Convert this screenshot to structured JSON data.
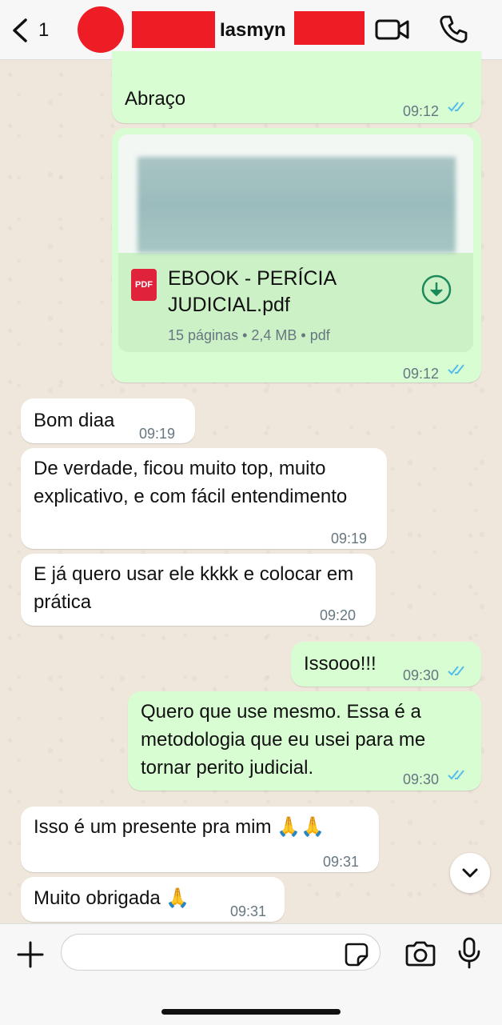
{
  "header": {
    "back_count": "1",
    "contact_name": "Iasmyn",
    "icons": {
      "back": "chevron-left-icon",
      "video": "video-camera-icon",
      "call": "phone-icon"
    }
  },
  "messages": [
    {
      "id": "m1",
      "direction": "out",
      "text": "Abraço",
      "time": "09:12",
      "read": true
    },
    {
      "id": "m2",
      "direction": "out",
      "type": "file",
      "file_icon_label": "PDF",
      "file_name": "EBOOK - PERÍCIA JUDICIAL.pdf",
      "file_meta": "15 páginas • 2,4 MB • pdf",
      "time": "09:12",
      "read": true
    },
    {
      "id": "m3",
      "direction": "in",
      "text": "Bom diaa",
      "time": "09:19"
    },
    {
      "id": "m4",
      "direction": "in",
      "text": "De verdade, ficou muito top, muito explicativo, e com fácil entendimento",
      "time": "09:19"
    },
    {
      "id": "m5",
      "direction": "in",
      "text": "E já quero usar ele kkkk e colocar em prática",
      "time": "09:20"
    },
    {
      "id": "m6",
      "direction": "out",
      "text": "Issooo!!!",
      "time": "09:30",
      "read": true
    },
    {
      "id": "m7",
      "direction": "out",
      "text": "Quero que use mesmo. Essa é a metodologia que eu usei para me tornar perito judicial.",
      "time": "09:30",
      "read": true
    },
    {
      "id": "m8",
      "direction": "in",
      "text": "Isso é um presente pra mim 🙏🙏",
      "time": "09:31"
    },
    {
      "id": "m9",
      "direction": "in",
      "text": "Muito obrigada 🙏",
      "time": "09:31"
    }
  ],
  "composer": {
    "placeholder": "",
    "icons": {
      "attach": "plus-icon",
      "sticker": "sticker-icon",
      "camera": "camera-icon",
      "mic": "microphone-icon"
    }
  },
  "scroll_button": {
    "icon": "chevron-down-icon"
  },
  "colors": {
    "outgoing": "#d9fdd3",
    "incoming": "#ffffff",
    "read_tick": "#53bdeb",
    "pdf_red": "#e0233b",
    "redaction": "#ee1c25"
  }
}
